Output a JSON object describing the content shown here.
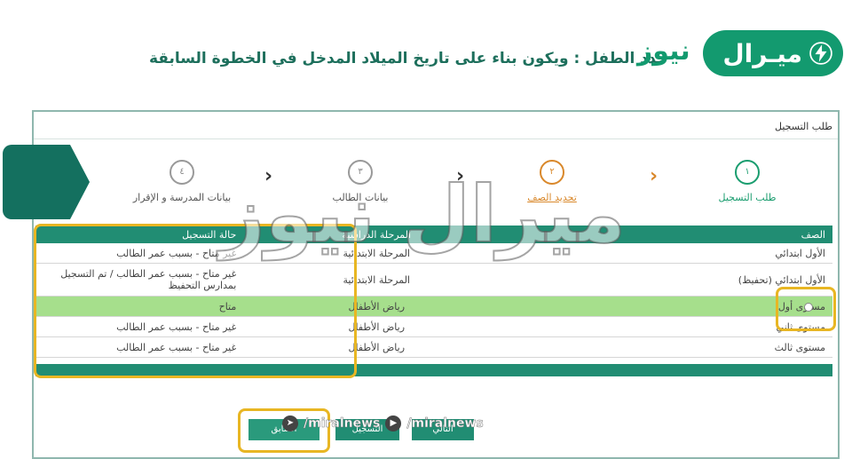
{
  "caption": "حدد الطفل : ويكون بناء على تاريخ الميلاد المدخل في الخطوة السابقة",
  "logo": {
    "word1": "ميـرال",
    "word2": "نيوز",
    "icon": "lightning-bolt-icon"
  },
  "frame": {
    "title": "طلب التسجيل"
  },
  "steps": [
    {
      "num": "١",
      "label": "طلب التسجيل"
    },
    {
      "num": "٢",
      "label": "تحديد الصف"
    },
    {
      "num": "٣",
      "label": "بيانات الطالب"
    },
    {
      "num": "٤",
      "label": "بيانات المدرسة و الإقرار"
    }
  ],
  "table": {
    "headers": [
      "الصف",
      "المرحلة الدراسية",
      "حالة التسجيل"
    ],
    "rows": [
      {
        "grade": "الأول ابتدائي",
        "stage": "المرحلة الابتدائية",
        "status": "غير متاح - بسبب عمر الطالب"
      },
      {
        "grade": "الأول ابتدائي (تحفيظ)",
        "stage": "المرحلة الابتدائية",
        "status": "غير متاح - بسبب عمر الطالب / تم التسجيل بمدارس التحفيظ"
      },
      {
        "grade": "مستوى أول",
        "stage": "رياض الأطفال",
        "status": "متاح"
      },
      {
        "grade": "مستوى ثاني",
        "stage": "رياض الأطفال",
        "status": "غير متاح - بسبب عمر الطالب"
      },
      {
        "grade": "مستوى ثالث",
        "stage": "رياض الأطفال",
        "status": "غير متاح - بسبب عمر الطالب"
      }
    ]
  },
  "buttons": {
    "back": "السابق",
    "register": "التسجيل",
    "next": "التالي"
  },
  "watermark": {
    "text": "ميرال نيوز",
    "handle1": "/miralnews",
    "handle2": "/miralnews"
  },
  "colors": {
    "brand": "#139a6f",
    "table_header": "#218d73",
    "selected_row": "#a6df8c",
    "highlight": "#e8b623",
    "active_step": "#d9882b"
  }
}
